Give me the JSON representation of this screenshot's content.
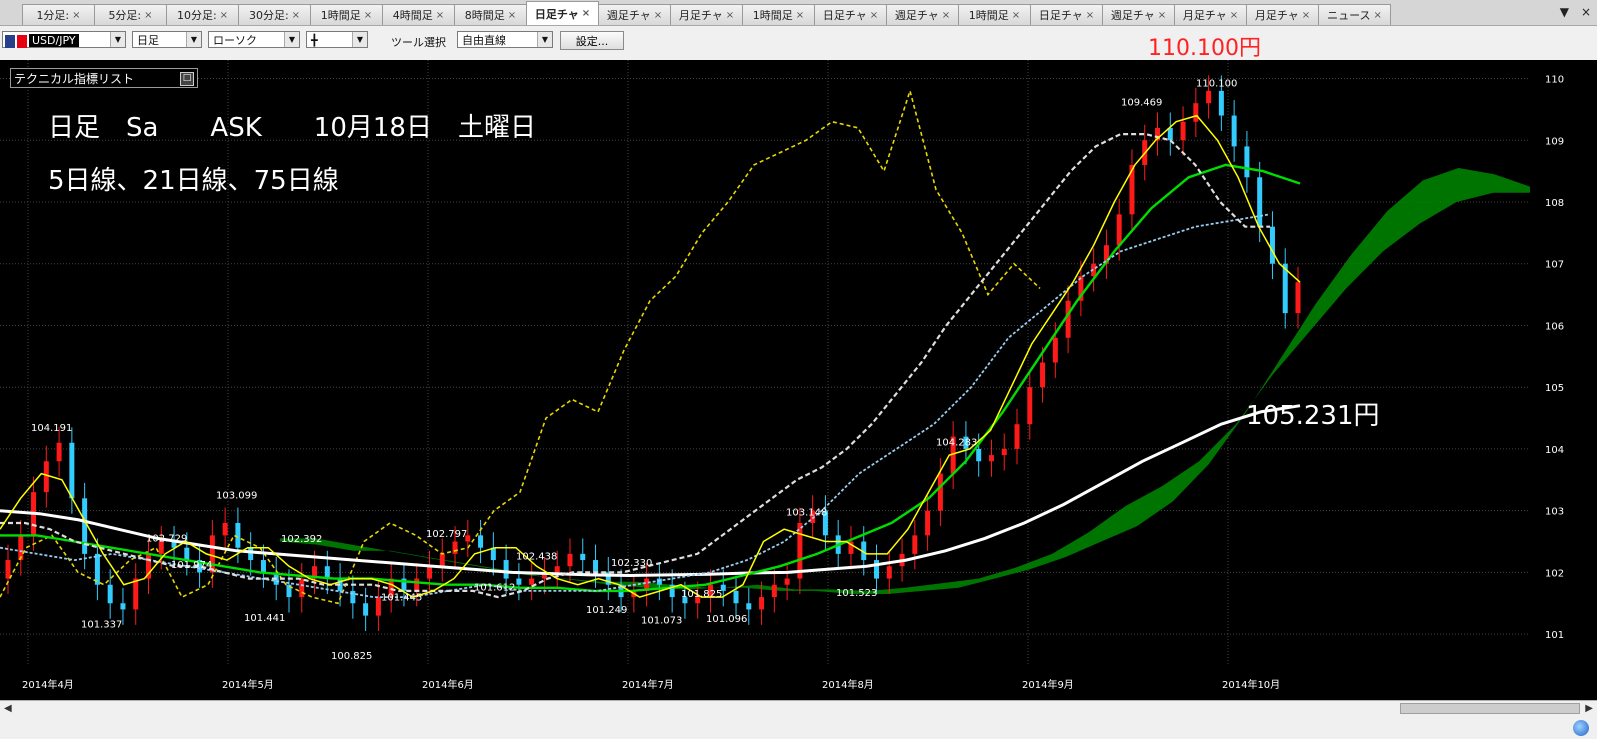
{
  "tabs": [
    {
      "label": "1分足:"
    },
    {
      "label": "5分足:"
    },
    {
      "label": "10分足:"
    },
    {
      "label": "30分足:"
    },
    {
      "label": "1時間足"
    },
    {
      "label": "4時間足"
    },
    {
      "label": "8時間足"
    },
    {
      "label": "日足チャ",
      "active": true
    },
    {
      "label": "週足チャ"
    },
    {
      "label": "月足チャ"
    },
    {
      "label": "1時間足"
    },
    {
      "label": "日足チャ"
    },
    {
      "label": "週足チャ"
    },
    {
      "label": "1時間足"
    },
    {
      "label": "日足チャ"
    },
    {
      "label": "週足チャ"
    },
    {
      "label": "月足チャ"
    },
    {
      "label": "月足チャ"
    },
    {
      "label": "ニュース"
    }
  ],
  "tab_close_glyph": "×",
  "tab_controls": {
    "menu": "▼",
    "close": "×"
  },
  "toolbar": {
    "symbol": "USD/JPY",
    "period": "日足",
    "chart_type": "ローソク",
    "candle_glyph": "╋",
    "tool_label": "ツール選択",
    "tool_value": "自由直線",
    "settings_label": "設定..."
  },
  "ask_price": "110.100円",
  "indicator_panel": {
    "label": "テクニカル指標リスト"
  },
  "overlay": {
    "line1": "日足　Sa　　ASK　　10月18日　土曜日",
    "line2": "5日線、21日線、75日線",
    "current_price": "105.231円"
  },
  "colors": {
    "background": "#000000",
    "up": "#ff1a1a",
    "down": "#33ccff",
    "ma5": "#ffff00",
    "ma21": "#dddddd",
    "ma75": "#ffffff",
    "kijun": "#00dd00",
    "tenkan": "#99ccee",
    "chikou": "#e8d800",
    "cloud_bull": "#008800",
    "cloud_bear": "#1e7a99"
  },
  "chart_data": {
    "type": "candlestick",
    "y_axis": {
      "min": 100.5,
      "max": 110.3,
      "ticks": [
        101,
        102,
        103,
        104,
        105,
        106,
        107,
        108,
        109,
        110
      ]
    },
    "x_labels": [
      "2014年4月",
      "2014年5月",
      "2014年6月",
      "2014年7月",
      "2014年8月",
      "2014年9月",
      "2014年10月"
    ],
    "annotations": [
      {
        "text": "104.191",
        "value": 104.191
      },
      {
        "text": "101.337",
        "value": 101.337
      },
      {
        "text": "103.099",
        "value": 103.099
      },
      {
        "text": "102.729",
        "value": 102.729
      },
      {
        "text": "101.974",
        "value": 101.974
      },
      {
        "text": "101.441",
        "value": 101.441
      },
      {
        "text": "102.392",
        "value": 102.392
      },
      {
        "text": "100.825",
        "value": 100.825
      },
      {
        "text": "101.445",
        "value": 101.445
      },
      {
        "text": "102.797",
        "value": 102.797
      },
      {
        "text": "101.612",
        "value": 101.612
      },
      {
        "text": "102.438",
        "value": 102.438
      },
      {
        "text": "101.249",
        "value": 101.249
      },
      {
        "text": "102.330",
        "value": 102.33
      },
      {
        "text": "101.073",
        "value": 101.073
      },
      {
        "text": "101.825",
        "value": 101.825
      },
      {
        "text": "101.096",
        "value": 101.096
      },
      {
        "text": "103.148",
        "value": 103.148
      },
      {
        "text": "101.523",
        "value": 101.523
      },
      {
        "text": "104.283",
        "value": 104.283
      },
      {
        "text": "109.469",
        "value": 109.469
      },
      {
        "text": "110.100",
        "value": 110.1
      }
    ],
    "closes": [
      102.2,
      102.6,
      103.3,
      103.8,
      104.1,
      103.2,
      102.3,
      101.8,
      101.5,
      101.4,
      101.9,
      102.3,
      102.5,
      102.4,
      102.2,
      102.0,
      102.6,
      102.8,
      102.4,
      102.2,
      102.0,
      101.8,
      101.6,
      101.9,
      102.1,
      101.9,
      101.7,
      101.5,
      101.3,
      101.6,
      101.9,
      101.7,
      101.9,
      102.1,
      102.3,
      102.5,
      102.6,
      102.4,
      102.2,
      101.9,
      101.8,
      101.9,
      102.0,
      102.1,
      102.3,
      102.2,
      102.0,
      101.8,
      101.6,
      101.7,
      101.9,
      101.8,
      101.6,
      101.5,
      101.6,
      101.8,
      101.7,
      101.5,
      101.4,
      101.6,
      101.8,
      101.9,
      102.8,
      103.0,
      102.6,
      102.3,
      102.5,
      102.2,
      101.9,
      102.1,
      102.3,
      102.6,
      103.0,
      103.6,
      104.2,
      104.0,
      103.8,
      103.9,
      104.0,
      104.4,
      105.0,
      105.4,
      105.8,
      106.4,
      106.8,
      107.0,
      107.3,
      107.8,
      108.6,
      109.0,
      109.2,
      109.0,
      109.3,
      109.6,
      109.8,
      109.4,
      108.9,
      108.4,
      107.6,
      107.0,
      106.2,
      106.7
    ],
    "ma5": [
      102.7,
      103.2,
      103.6,
      103.5,
      102.9,
      102.3,
      101.8,
      101.9,
      102.3,
      102.5,
      102.3,
      102.2,
      102.4,
      102.4,
      102.1,
      101.9,
      101.8,
      101.9,
      101.9,
      101.8,
      101.6,
      101.7,
      101.9,
      102.3,
      102.4,
      102.4,
      102.1,
      101.9,
      101.8,
      101.9,
      101.8,
      101.6,
      101.7,
      101.8,
      101.6,
      101.6,
      101.8,
      102.5,
      102.7,
      102.6,
      102.5,
      102.5,
      102.3,
      102.3,
      102.7,
      103.3,
      103.9,
      104.0,
      104.3,
      105.0,
      105.7,
      106.2,
      106.7,
      107.3,
      108.0,
      108.6,
      109.0,
      109.3,
      109.4,
      109.0,
      108.4,
      107.6,
      107.0,
      106.7
    ],
    "ma21": [
      102.8,
      102.8,
      102.7,
      102.5,
      102.4,
      102.3,
      102.2,
      102.1,
      102.1,
      102.0,
      101.9,
      101.9,
      101.9,
      101.8,
      101.8,
      101.8,
      101.7,
      101.7,
      101.7,
      101.7,
      101.6,
      101.7,
      101.9,
      102.0,
      102.0,
      102.0,
      102.1,
      102.2,
      102.3,
      102.6,
      102.9,
      103.2,
      103.5,
      103.7,
      104.0,
      104.4,
      104.9,
      105.4,
      106.0,
      106.5,
      107.0,
      107.5,
      108.0,
      108.5,
      108.9,
      109.1,
      109.1,
      109.0,
      108.6,
      108.0,
      107.6,
      107.6
    ],
    "ma75": [
      103.0,
      102.95,
      102.85,
      102.7,
      102.55,
      102.45,
      102.35,
      102.3,
      102.25,
      102.2,
      102.15,
      102.1,
      102.05,
      102.0,
      101.98,
      101.96,
      101.95,
      101.96,
      101.97,
      101.99,
      102.0,
      102.05,
      102.1,
      102.2,
      102.35,
      102.55,
      102.8,
      103.1,
      103.45,
      103.8,
      104.1,
      104.4,
      104.6,
      104.7
    ],
    "kijun": [
      102.6,
      102.6,
      102.5,
      102.4,
      102.3,
      102.2,
      102.1,
      102.0,
      101.95,
      101.9,
      101.9,
      101.85,
      101.8,
      101.8,
      101.75,
      101.75,
      101.7,
      101.7,
      101.75,
      101.8,
      101.95,
      102.1,
      102.3,
      102.55,
      102.8,
      103.2,
      103.8,
      104.6,
      105.5,
      106.4,
      107.2,
      107.9,
      108.4,
      108.6,
      108.5,
      108.3
    ],
    "tenkan": [
      102.4,
      102.3,
      102.2,
      102.3,
      102.2,
      102.1,
      102.0,
      101.9,
      101.8,
      101.7,
      101.6,
      101.6,
      101.7,
      101.8,
      101.7,
      101.7,
      101.7,
      101.8,
      101.9,
      102.0,
      102.2,
      102.5,
      103.0,
      103.6,
      104.0,
      104.4,
      105.0,
      105.8,
      106.3,
      106.8,
      107.2,
      107.4,
      107.6,
      107.7,
      107.8
    ],
    "chikou": [
      101.6,
      102.4,
      102.6,
      102.0,
      101.8,
      102.2,
      102.4,
      101.6,
      101.8,
      102.6,
      102.4,
      101.8,
      101.6,
      101.5,
      102.5,
      102.8,
      102.6,
      102.3,
      102.4,
      103.0,
      103.3,
      104.5,
      104.8,
      104.6,
      105.6,
      106.4,
      106.8,
      107.5,
      108.0,
      108.6,
      108.8,
      109.0,
      109.3,
      109.2,
      108.5,
      109.8,
      108.2,
      107.5,
      106.5,
      107.0,
      106.6
    ]
  }
}
